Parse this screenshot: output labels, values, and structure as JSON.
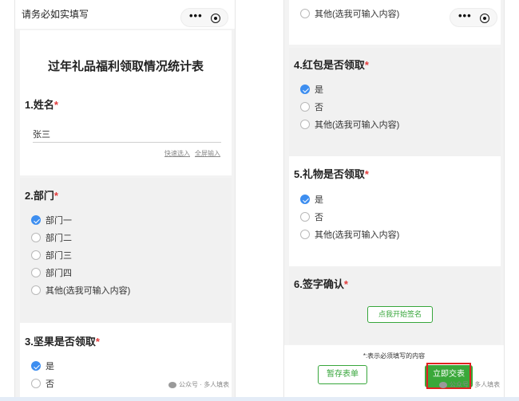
{
  "left": {
    "topbar_title": "请务必如实填写",
    "form_title": "过年礼品福利领取情况统计表",
    "q1": {
      "title": "1.姓名",
      "required_mark": "*",
      "value": "张三",
      "helper_quick": "快速选入",
      "helper_full": "全屏输入"
    },
    "q2": {
      "title": "2.部门",
      "required_mark": "*",
      "options": [
        "部门一",
        "部门二",
        "部门三",
        "部门四",
        "其他(选我可输入内容)"
      ],
      "selected": "部门一"
    },
    "q3": {
      "title": "3.坚果是否领取",
      "required_mark": "*",
      "options": [
        "是",
        "否"
      ],
      "selected": "是"
    },
    "watermark": "公众号 · 多人填表"
  },
  "right": {
    "top_option": "其他(选我可输入内容)",
    "q4": {
      "title": "4.红包是否领取",
      "required_mark": "*",
      "options": [
        "是",
        "否",
        "其他(选我可输入内容)"
      ],
      "selected": "是"
    },
    "q5": {
      "title": "5.礼物是否领取",
      "required_mark": "*",
      "options": [
        "是",
        "否",
        "其他(选我可输入内容)"
      ],
      "selected": "是"
    },
    "q6": {
      "title": "6.签字确认",
      "required_mark": "*",
      "sign_button": "点我开始签名"
    },
    "footer": {
      "required_note": "*:表示必须填写的内容",
      "draft_button": "暂存表单",
      "submit_button": "立即交表",
      "watermark": "公众号 · 多人填表"
    }
  },
  "icons": [
    "more-icon",
    "target-icon",
    "check-icon",
    "wechat-icon"
  ],
  "colors": {
    "accent_blue": "#3d8ef0",
    "accent_green": "#3aa83a",
    "required_red": "#e23b3b",
    "highlight_red": "#e02020"
  }
}
